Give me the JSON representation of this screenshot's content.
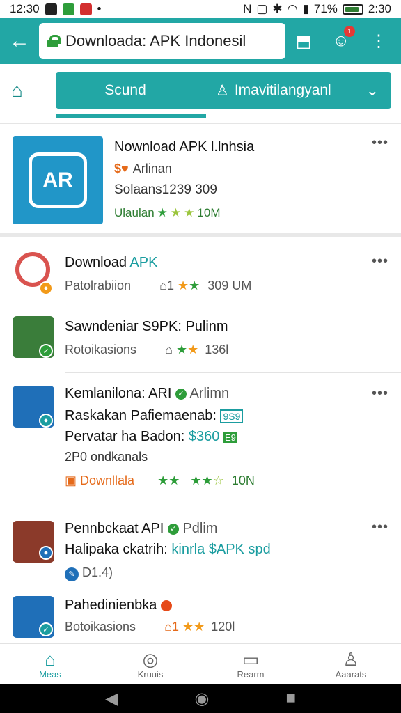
{
  "status_bar": {
    "time": "12:30",
    "battery_pct": "71%",
    "clock_right": "2:30"
  },
  "top_bar": {
    "url_text": "Downloada: APK Indonesil",
    "notif_count": "1"
  },
  "tabs": {
    "tab1": "Scund",
    "tab2": "Imavitilangyanl"
  },
  "featured": {
    "title": "Nownload APK l.lnhsia",
    "sub": "Arlinan",
    "downloads": "Solaans1239 309",
    "rating_label": "Ulaulan",
    "rating_count": "10M",
    "icon_text": "AR"
  },
  "items": [
    {
      "title_a": "Download",
      "title_b": "APK",
      "sub": "Patolrabiion",
      "meta": "1",
      "count": "309 UM"
    },
    {
      "title": "Sawndeniar S9PK: Pulinm",
      "sub": "Rotoikasions",
      "count": "136l"
    },
    {
      "title": "Kemlanilona: ARI",
      "tag": "Arlimn",
      "line2": "Raskakan Pafiemaenab:",
      "line2_tag": "9S9",
      "line3": "Pervatar ha Badon:",
      "line3_price": "$360",
      "line3_tag": "E9",
      "line4": "2P0 ondkanals",
      "action": "Downllala",
      "count": "10N"
    },
    {
      "title": "Pennbckaat API",
      "tag": "Pdlim",
      "line2": "Halipaka ckatrih:",
      "line2_link": "kinrla $APK spd",
      "line3": "D1.4)"
    },
    {
      "title": "Pahedinienbka",
      "sub": "Botoikasions",
      "meta": "1",
      "count": "120l"
    }
  ],
  "bottom_nav": [
    "Meas",
    "Kruuis",
    "Rearm",
    "Aaarats"
  ]
}
